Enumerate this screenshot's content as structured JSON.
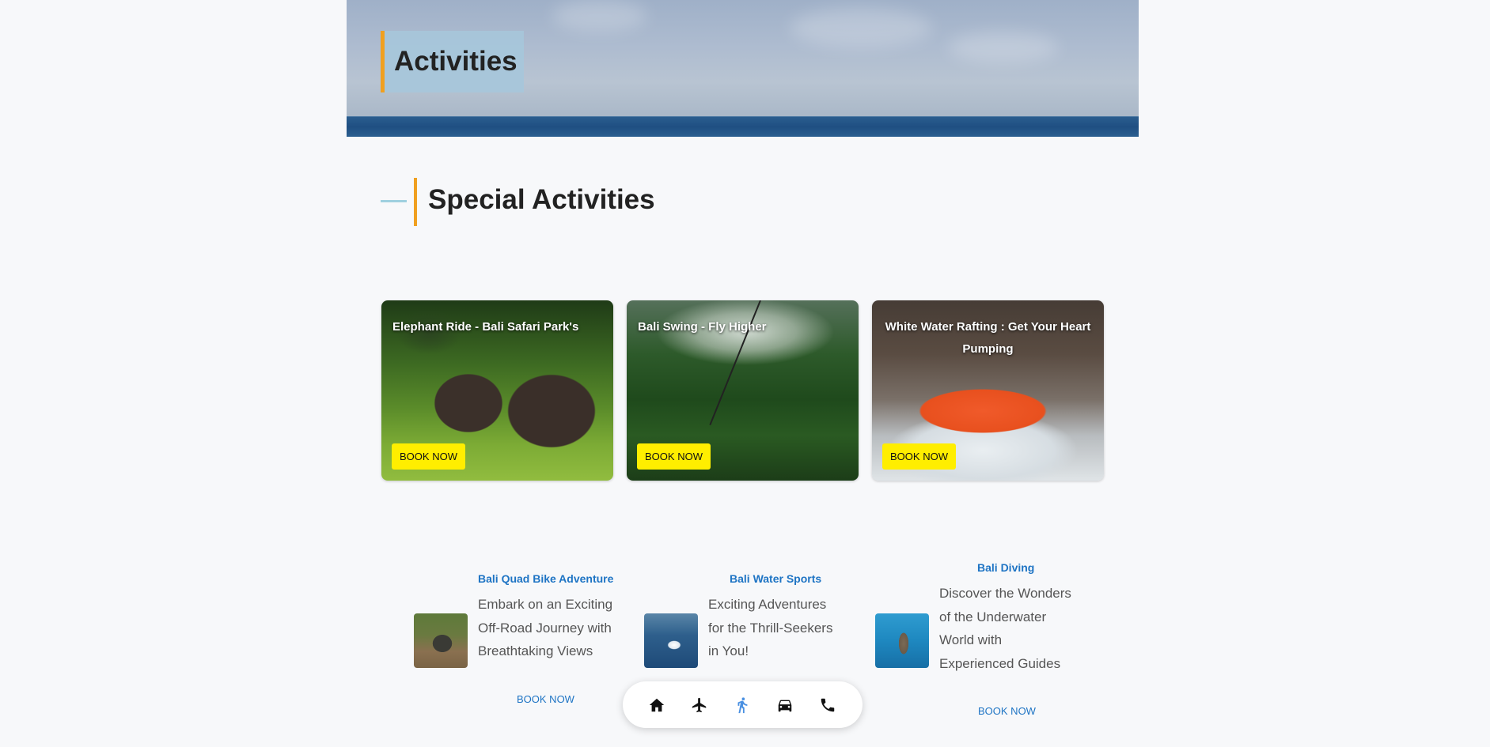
{
  "hero": {
    "title": "Activities"
  },
  "section": {
    "title": "Special Activities"
  },
  "cards": [
    {
      "title": "Elephant Ride - Bali Safari Park's",
      "button": "BOOK NOW"
    },
    {
      "title": "Bali Swing - Fly Higher",
      "button": "BOOK NOW"
    },
    {
      "title": "White Water Rafting : Get Your Heart Pumping",
      "button": "BOOK NOW"
    }
  ],
  "items": [
    {
      "heading": "Bali Quad Bike Adventure",
      "desc": "Embark on an Exciting Off-Road Journey with Breathtaking Views",
      "link": "BOOK NOW"
    },
    {
      "heading": "Bali Water Sports",
      "desc": "Exciting Adventures for the Thrill-Seekers in You!",
      "link": ""
    },
    {
      "heading": "Bali Diving",
      "desc": "Discover the Wonders of the Underwater World with Experienced Guides",
      "link": "BOOK NOW"
    }
  ],
  "bottom_nav": {
    "items": [
      {
        "icon": "home-icon",
        "active": false
      },
      {
        "icon": "airplane-icon",
        "active": false
      },
      {
        "icon": "walking-icon",
        "active": true
      },
      {
        "icon": "car-icon",
        "active": false
      },
      {
        "icon": "phone-icon",
        "active": false
      }
    ],
    "active_color": "#4a90e2",
    "color": "#111111"
  },
  "colors": {
    "accent": "#f0a020",
    "book_button": "#ffee00",
    "link": "#1e74c4"
  }
}
